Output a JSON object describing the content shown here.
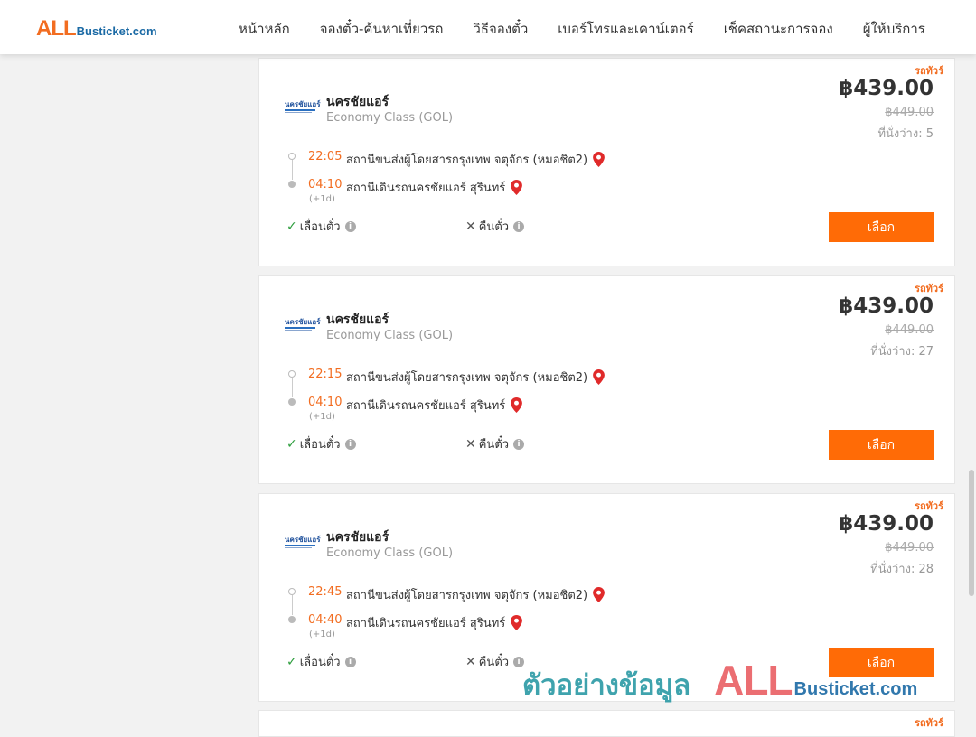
{
  "header": {
    "logo_all": "ALL",
    "logo_rest": "Busticket.com",
    "nav": [
      "หน้าหลัก",
      "จองตั๋ว-ค้นหาเที่ยวรถ",
      "วิธีจองตั๋ว",
      "เบอร์โทรและเคาน์เตอร์",
      "เช็คสถานะการจอง",
      "ผู้ให้บริการ"
    ]
  },
  "colors": {
    "accent": "#ff6b06",
    "brand_orange": "#f26d21",
    "brand_blue": "#1b6aa5",
    "check_green": "#2e9e3e"
  },
  "trips": [
    {
      "tag": "รถทัวร์",
      "operator_logo_text": "นครชัยแอร์",
      "operator": "นครชัยแอร์",
      "class": "Economy Class (GOL)",
      "depart_time": "22:05",
      "depart_station": "สถานีขนส่งผู้โดยสารกรุงเทพ จตุจักร (หมอชิต2)",
      "arrive_time": "04:10",
      "arrive_station": "สถานีเดินรถนครชัยแอร์ สุรินทร์",
      "day_offset": "(+1d)",
      "feature_change": "เลื่อนตั๋ว",
      "feature_refund": "คืนตั๋ว",
      "price": "฿439.00",
      "old_price": "฿449.00",
      "seats": "ที่นั่งว่าง: 5",
      "button": "เลือก"
    },
    {
      "tag": "รถทัวร์",
      "operator_logo_text": "นครชัยแอร์",
      "operator": "นครชัยแอร์",
      "class": "Economy Class (GOL)",
      "depart_time": "22:15",
      "depart_station": "สถานีขนส่งผู้โดยสารกรุงเทพ จตุจักร (หมอชิต2)",
      "arrive_time": "04:10",
      "arrive_station": "สถานีเดินรถนครชัยแอร์ สุรินทร์",
      "day_offset": "(+1d)",
      "feature_change": "เลื่อนตั๋ว",
      "feature_refund": "คืนตั๋ว",
      "price": "฿439.00",
      "old_price": "฿449.00",
      "seats": "ที่นั่งว่าง: 27",
      "button": "เลือก"
    },
    {
      "tag": "รถทัวร์",
      "operator_logo_text": "นครชัยแอร์",
      "operator": "นครชัยแอร์",
      "class": "Economy Class (GOL)",
      "depart_time": "22:45",
      "depart_station": "สถานีขนส่งผู้โดยสารกรุงเทพ จตุจักร (หมอชิต2)",
      "arrive_time": "04:40",
      "arrive_station": "สถานีเดินรถนครชัยแอร์ สุรินทร์",
      "day_offset": "(+1d)",
      "feature_change": "เลื่อนตั๋ว",
      "feature_refund": "คืนตั๋ว",
      "price": "฿439.00",
      "old_price": "฿449.00",
      "seats": "ที่นั่งว่าง: 28",
      "button": "เลือก"
    }
  ],
  "partial_card": {
    "tag": "รถทัวร์"
  },
  "watermark": {
    "thai": "ตัวอย่างข้อมูล",
    "all": "ALL",
    "rest": "Busticket.com"
  }
}
